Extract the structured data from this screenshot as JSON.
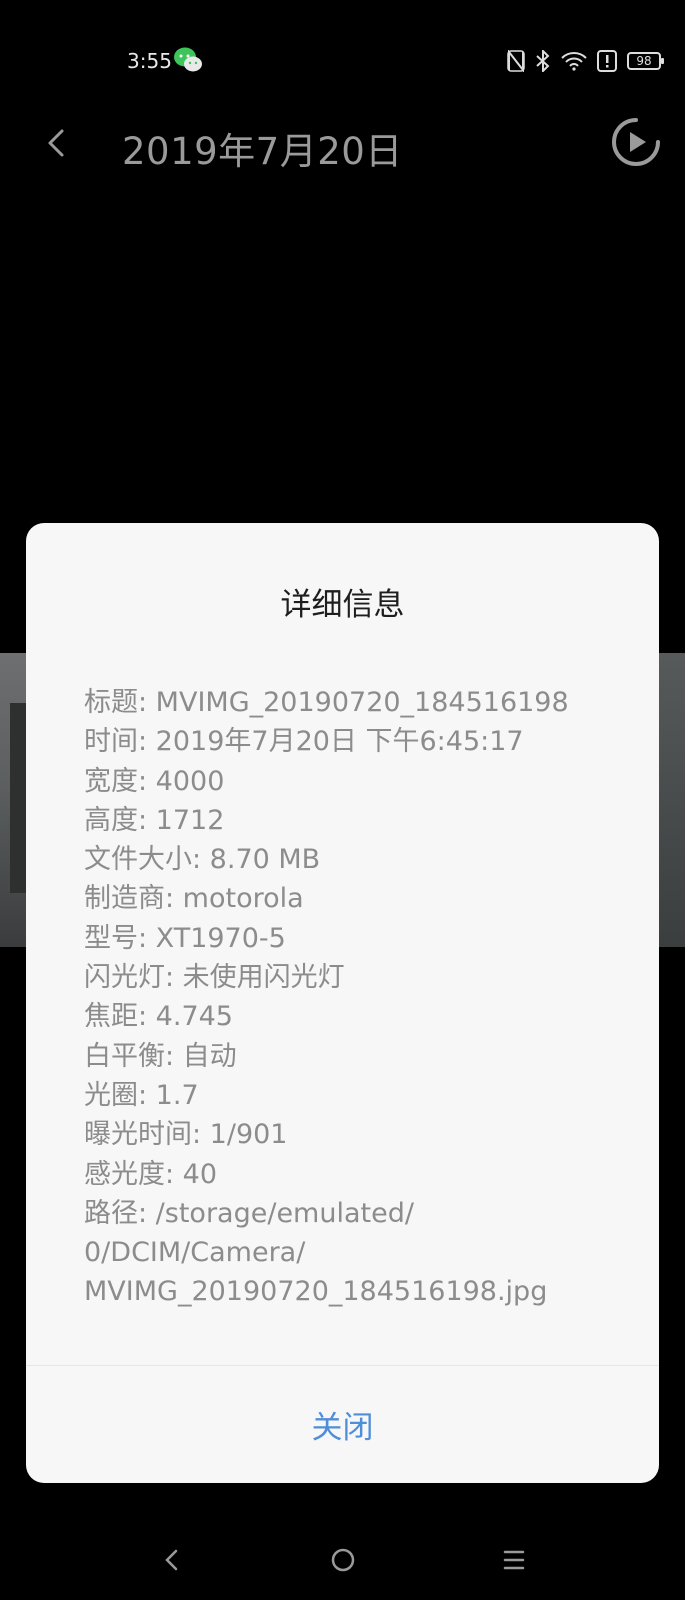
{
  "status_bar": {
    "time": "3:55",
    "battery": "98",
    "icons": [
      "wechat-icon",
      "nfc-icon",
      "bluetooth-icon",
      "wifi-icon",
      "alert-icon",
      "battery-icon"
    ]
  },
  "header": {
    "title": "2019年7月20日"
  },
  "dialog": {
    "title": "详细信息",
    "rows": [
      "标题: MVIMG_20190720_184516198",
      "时间: 2019年7月20日 下午6:45:17",
      "宽度: 4000",
      "高度: 1712",
      "文件大小: 8.70 MB",
      "制造商: motorola",
      "型号: XT1970-5",
      "闪光灯: 未使用闪光灯",
      "焦距: 4.745",
      "白平衡: 自动",
      "光圈: 1.7",
      "曝光时间: 1/901",
      "感光度: 40"
    ],
    "path_lines": [
      "路径: /storage/emulated/",
      "0/DCIM/Camera/",
      "MVIMG_20190720_184516198.jpg"
    ],
    "close_label": "关闭"
  },
  "colors": {
    "background": "#000000",
    "dialog": "#f7f7f7",
    "accent": "#4f8fd9",
    "info_text": "#8c8c8c"
  }
}
